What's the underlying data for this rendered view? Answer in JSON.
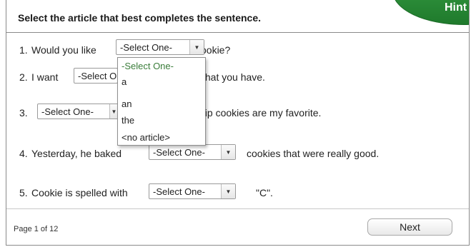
{
  "header": {
    "instruction": "Select the article that best completes the sentence.",
    "hint_label": "Hint"
  },
  "questions": [
    {
      "number": "1.",
      "before": "Would you like",
      "after": "cookie?",
      "selected": "-Select One-"
    },
    {
      "number": "2.",
      "before": "I want",
      "after": "that you have.",
      "selected": "-Select O"
    },
    {
      "number": "3.",
      "before": "",
      "after": "hip cookies are my favorite.",
      "selected": "-Select One-"
    },
    {
      "number": "4.",
      "before": "Yesterday, he baked",
      "after": "cookies that were really good.",
      "selected": "-Select One-"
    },
    {
      "number": "5.",
      "before": "Cookie is spelled with",
      "after": "\"C\".",
      "selected": "-Select One-"
    }
  ],
  "dropdown": {
    "open_for_question": "1.",
    "options": [
      "-Select One-",
      "a",
      "an",
      "the",
      "<no article>"
    ],
    "highlighted": "-Select One-"
  },
  "footer": {
    "page_info": "Page 1 of 12",
    "next_label": "Next"
  },
  "colors": {
    "hint_green": "#2e8f3c",
    "option_highlight": "#3a7d3a",
    "border": "#8a8a8a"
  },
  "icons": {
    "select_arrow": "triangle-down-icon"
  }
}
